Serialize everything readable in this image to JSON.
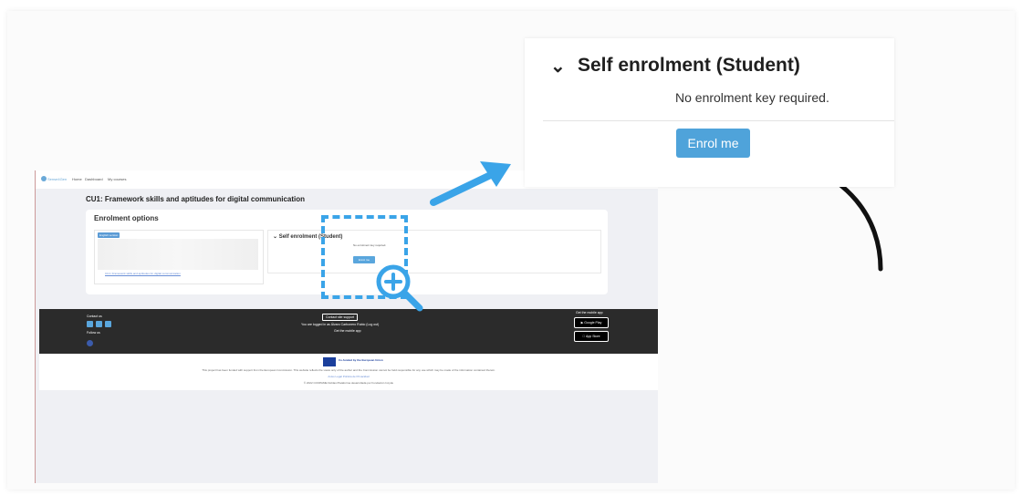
{
  "small_page": {
    "nav": {
      "logo": "Sense4Gen",
      "items": [
        "Home",
        "Dashboard",
        "My courses"
      ]
    },
    "course_title": "CU1: Framework skills and aptitudes for digital communication",
    "enrolment_heading": "Enrolment options",
    "badge": "English version",
    "course_link": "CU1: Framework skills and aptitudes for digital communication",
    "self_enrolment_title": "Self enrolment (Student)",
    "no_key": "No enrolment key required.",
    "enrol_button": "Enrol me",
    "footer": {
      "contact": "Contact us",
      "follow": "Follow us",
      "support": "Contact site support",
      "logged_in": "You are logged in as Álvaro Carbonero Rubio (Log out)",
      "get_app_center": "Get the mobile app",
      "get_app_right": "Get the mobile app",
      "google_play": "Google Play",
      "app_store": "App Store"
    },
    "eu": {
      "cofunded": "Co-funded by the European Union",
      "disclaimer": "This project has been funded with support from the European Commission. This website reflects the views only of the author and the Commission cannot be held responsible for any use which may be made of the information contained therein.",
      "legal": "Aviso Legal   Política de Privacidad",
      "copyright": "© 2022 COOPAME Doblas Plataforma desarrollada por Fundación Incyde"
    }
  },
  "zoom_panel": {
    "title": "Self enrolment (Student)",
    "no_key": "No enrolment key required.",
    "enrol_button": "Enrol me"
  },
  "colors": {
    "accent": "#4fa3da",
    "arrow_blue": "#3aa4e8",
    "footer_bg": "#2b2b2b"
  }
}
